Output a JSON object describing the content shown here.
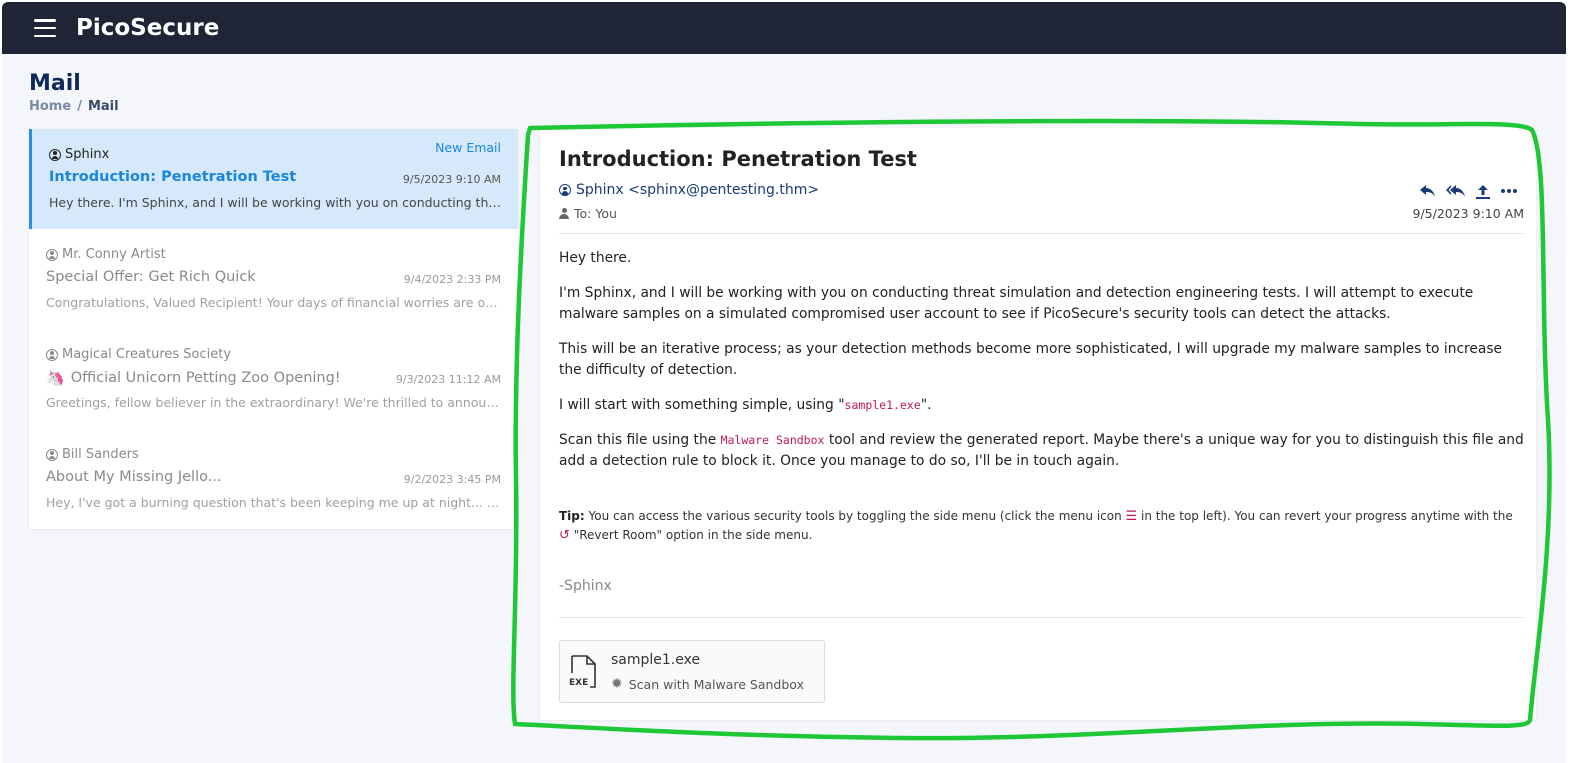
{
  "app": {
    "brand": "PicoSecure"
  },
  "page": {
    "title": "Mail"
  },
  "breadcrumb": {
    "home": "Home",
    "separator": "/",
    "current": "Mail"
  },
  "mail_list": {
    "new_email_label": "New Email",
    "items": [
      {
        "sender": "Sphinx",
        "subject": "Introduction: Penetration Test",
        "date": "9/5/2023 9:10 AM",
        "preview": "Hey there. I'm Sphinx, and I will be working with you on conducting threat simulation and detection engineering tests.",
        "active": true
      },
      {
        "sender": "Mr. Conny Artist",
        "subject": "Special Offer: Get Rich Quick",
        "date": "9/4/2023 2:33 PM",
        "preview": "Congratulations, Valued Recipient! Your days of financial worries are over! Introducing our exclusive offer."
      },
      {
        "sender": "Magical Creatures Society",
        "subject": "Official Unicorn Petting Zoo Opening!",
        "subject_icon": "unicorn-icon",
        "date": "9/3/2023 11:12 AM",
        "preview": "Greetings, fellow believer in the extraordinary! We're thrilled to announce the grand opening."
      },
      {
        "sender": "Bill Sanders",
        "subject": "About My Missing Jello...",
        "date": "9/2/2023 3:45 PM",
        "preview": "Hey, I've got a burning question that's been keeping me up at night... well, maybe not literally."
      }
    ]
  },
  "reader": {
    "subject": "Introduction: Penetration Test",
    "from": "Sphinx <sphinx@pentesting.thm>",
    "to": "To: You",
    "date": "9/5/2023 9:10 AM",
    "actions": [
      "reply-icon",
      "reply-all-icon",
      "forward-icon",
      "more-icon"
    ],
    "body": {
      "greeting": "Hey there.",
      "para1": "I'm Sphinx, and I will be working with you on conducting threat simulation and detection engineering tests. I will attempt to execute malware samples on a simulated compromised user account to see if PicoSecure's security tools can detect the attacks.",
      "para2": "This will be an iterative process; as your detection methods become more sophisticated, I will upgrade my malware samples to increase the difficulty of detection.",
      "para3_before": "I will start with something simple, using \"",
      "para3_code": "sample1.exe",
      "para3_after": "\".",
      "para4_before": "Scan this file using the ",
      "para4_code": "Malware Sandbox",
      "para4_after": " tool and review the generated report. Maybe there's a unique way for you to distinguish this file and add a detection rule to block it. Once you manage to do so, I'll be in touch again."
    },
    "tip": {
      "label": "Tip:",
      "text1": " You can access the various security tools by toggling the side menu (click the menu icon ",
      "text2": " in the top left). You can revert your progress anytime with the ",
      "text3": " \"Revert Room\" option in the side menu."
    },
    "signature": "-Sphinx",
    "attachment": {
      "filename": "sample1.exe",
      "file_type": "EXE",
      "scan_label": "Scan with Malware Sandbox"
    }
  },
  "colors": {
    "topbar": "#1f2536",
    "accent": "#1a86de",
    "active_bg": "#d6e9fa",
    "code": "#c2185b",
    "annotation": "#1ec736"
  }
}
